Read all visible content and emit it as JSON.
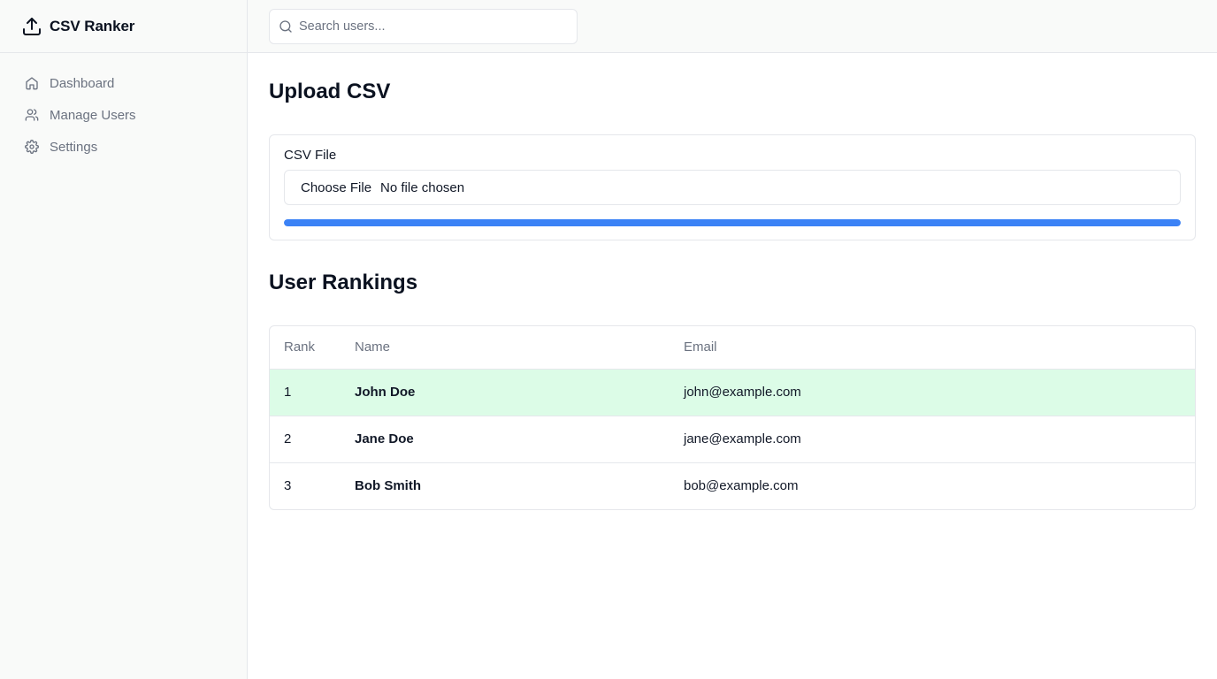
{
  "app": {
    "title": "CSV Ranker",
    "brand_icon": "upload-icon"
  },
  "sidebar": {
    "items": [
      {
        "label": "Dashboard",
        "icon": "home-icon"
      },
      {
        "label": "Manage Users",
        "icon": "users-icon"
      },
      {
        "label": "Settings",
        "icon": "gear-icon"
      }
    ]
  },
  "search": {
    "placeholder": "Search users...",
    "value": ""
  },
  "upload": {
    "title": "Upload CSV",
    "field_label": "CSV File",
    "file_button_label": "Choose File",
    "file_status": "No file chosen",
    "progress": 1.0,
    "progress_color": "#3b82f6"
  },
  "rankings": {
    "title": "User Rankings",
    "columns": [
      "Rank",
      "Name",
      "Email"
    ],
    "rows": [
      {
        "rank": "1",
        "name": "John Doe",
        "email": "john@example.com",
        "highlight": true
      },
      {
        "rank": "2",
        "name": "Jane Doe",
        "email": "jane@example.com",
        "highlight": false
      },
      {
        "rank": "3",
        "name": "Bob Smith",
        "email": "bob@example.com",
        "highlight": false
      }
    ],
    "highlight_color": "#dcfce7"
  }
}
